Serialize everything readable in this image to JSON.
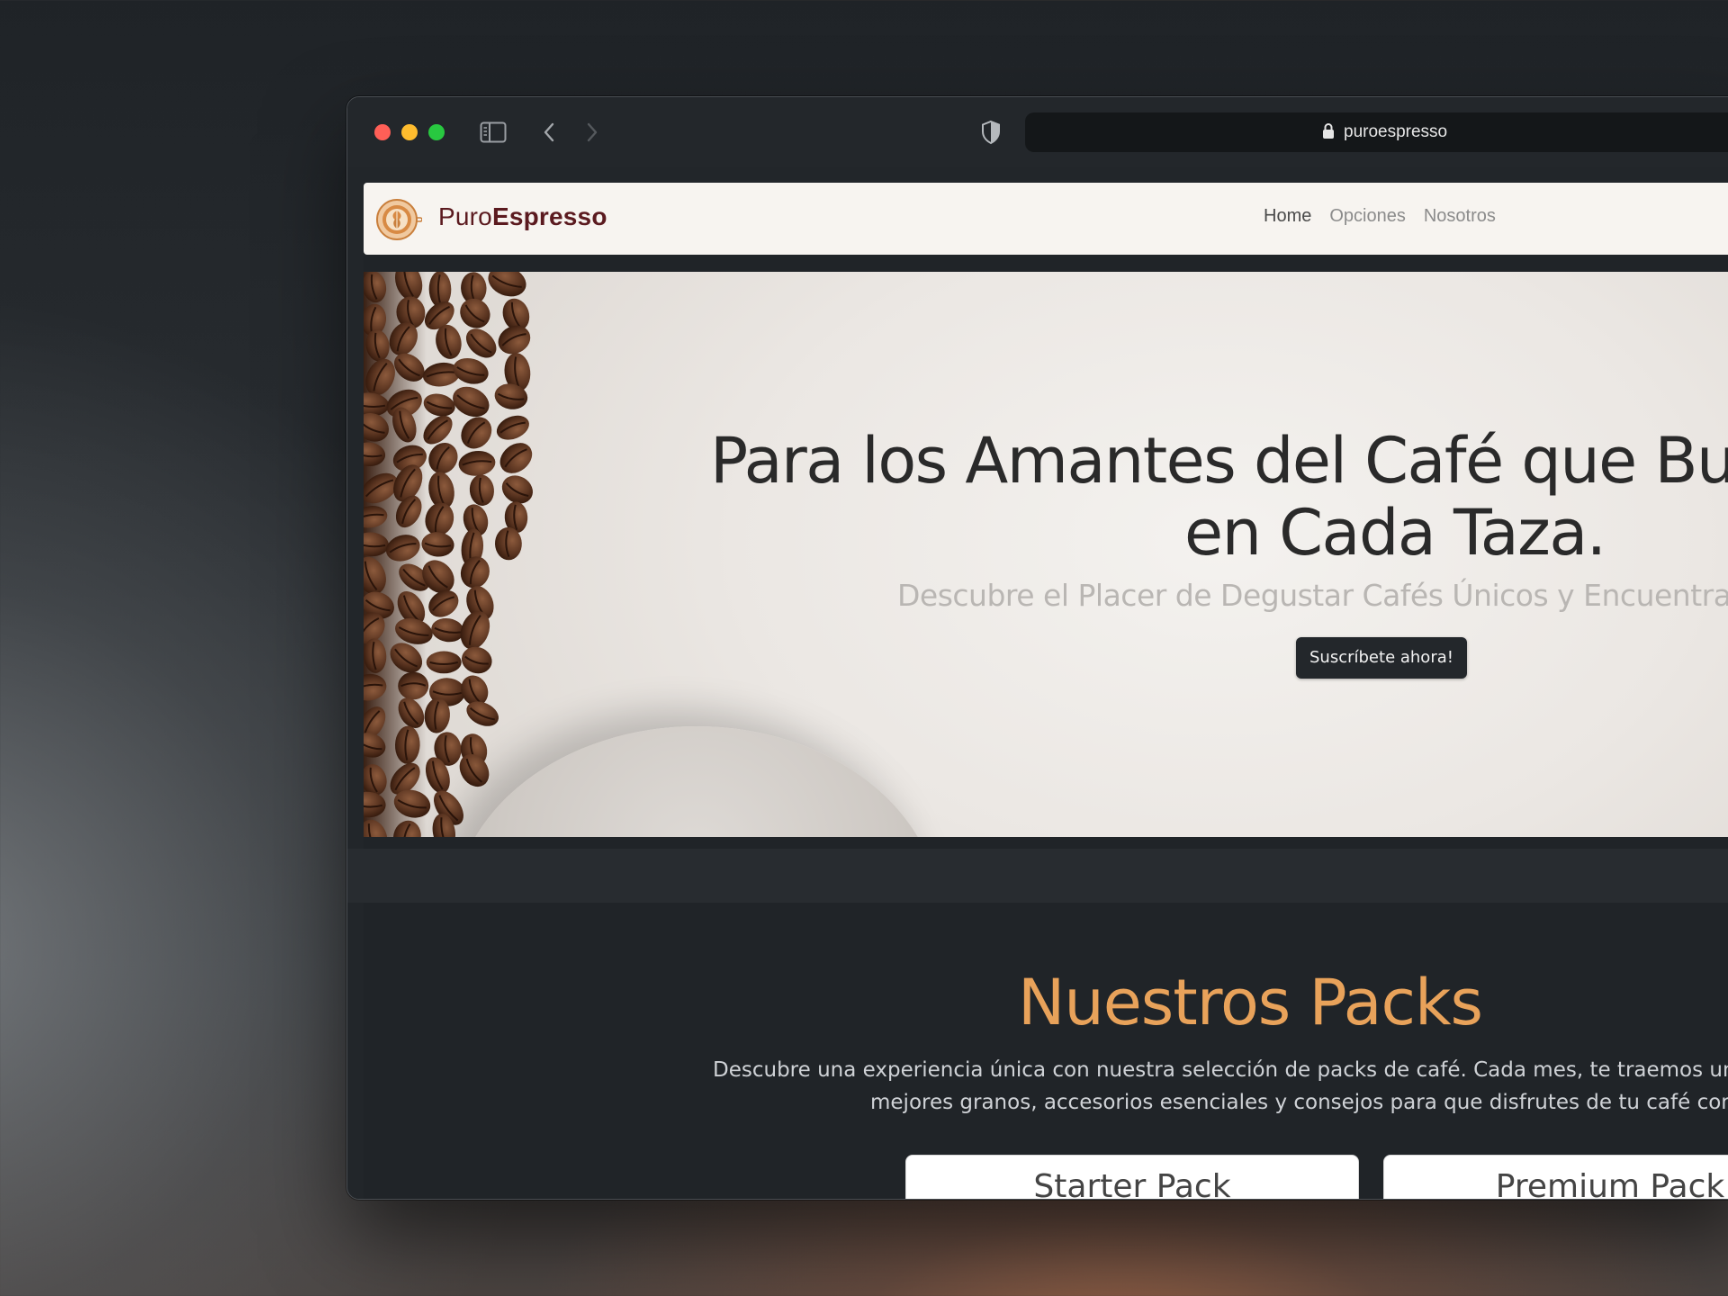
{
  "browser": {
    "url": "puroespresso",
    "icons": {
      "sidebar": "sidebar-icon",
      "back": "chevron-left-icon",
      "forward": "chevron-right-icon",
      "privacy": "shield-icon",
      "lock": "lock-icon",
      "reload": "reload-icon"
    }
  },
  "site": {
    "brand_light": "Puro",
    "brand_bold": "Espresso",
    "logo_icon": "latte-art-logo-icon",
    "nav": [
      {
        "label": "Home",
        "active": true
      },
      {
        "label": "Opciones",
        "active": false
      },
      {
        "label": "Nosotros",
        "active": false
      }
    ]
  },
  "hero": {
    "title_line1": "Para los Amantes del Café que Busc",
    "title_line2": "en Cada Taza.",
    "subtitle": "Descubre el Placer de Degustar Cafés Únicos y Encuentra t",
    "cta_label": "Suscríbete ahora!"
  },
  "packs": {
    "title": "Nuestros Packs",
    "description_line1": "Descubre una experiencia única con nuestra selección de packs de café. Cada mes, te traemos un",
    "description_line2": "mejores granos, accesorios esenciales y consejos para que disfrutes de tu café com",
    "cards": [
      {
        "title": "Starter Pack"
      },
      {
        "title": "Premium Pack"
      }
    ]
  },
  "colors": {
    "accent": "#e8a25a",
    "brand": "#5b1a1f",
    "page_dark": "#202428",
    "traffic_red": "#ff5f57",
    "traffic_yellow": "#febc2e",
    "traffic_green": "#28c840"
  }
}
